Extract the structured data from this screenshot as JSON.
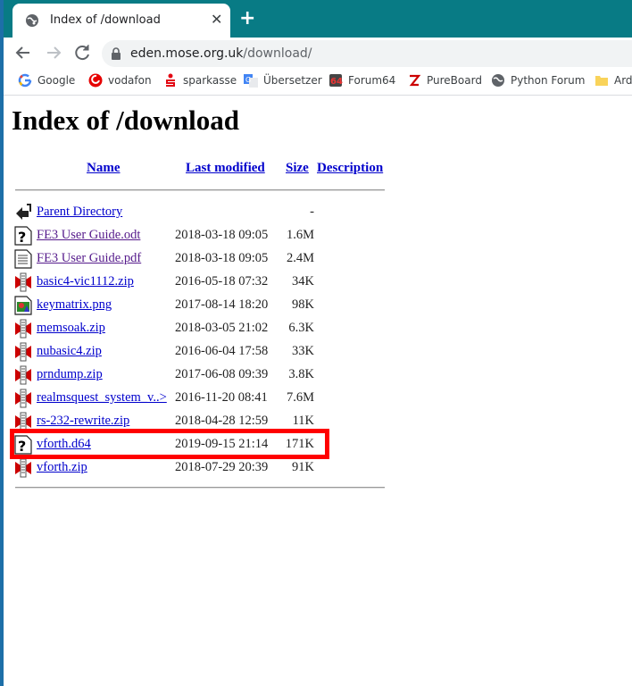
{
  "tab": {
    "title": "Index of /download",
    "close": "✕"
  },
  "newtab": "+",
  "url": {
    "host": "eden.mose.org.uk",
    "path": "/download/"
  },
  "bookmarks": [
    {
      "label": "Google",
      "icon": "google-icon"
    },
    {
      "label": "vodafon",
      "icon": "vodafone-icon"
    },
    {
      "label": "sparkasse",
      "icon": "sparkasse-icon"
    },
    {
      "label": "Übersetzer",
      "icon": "translate-icon"
    },
    {
      "label": "Forum64",
      "icon": "forum64-icon"
    },
    {
      "label": "PureBoard",
      "icon": "pureboard-icon"
    },
    {
      "label": "Python Forum",
      "icon": "globe-icon"
    },
    {
      "label": "Ard",
      "icon": "folder-icon"
    }
  ],
  "page": {
    "title": "Index of /download",
    "headers": {
      "name": "Name",
      "modified": "Last modified",
      "size": "Size",
      "description": "Description"
    },
    "rows": [
      {
        "name": "Parent Directory",
        "date": "",
        "size": "-",
        "icon": "back-icon"
      },
      {
        "name": "FE3 User Guide.odt",
        "date": "2018-03-18 09:05",
        "size": "1.6M",
        "icon": "unknown-file-icon"
      },
      {
        "name": "FE3 User Guide.pdf",
        "date": "2018-03-18 09:05",
        "size": "2.4M",
        "icon": "text-file-icon"
      },
      {
        "name": "basic4-vic1112.zip",
        "date": "2016-05-18 07:32",
        "size": "34K",
        "icon": "compressed-icon"
      },
      {
        "name": "keymatrix.png",
        "date": "2017-08-14 18:20",
        "size": "98K",
        "icon": "image-icon"
      },
      {
        "name": "memsoak.zip",
        "date": "2018-03-05 21:02",
        "size": "6.3K",
        "icon": "compressed-icon"
      },
      {
        "name": "nubasic4.zip",
        "date": "2016-06-04 17:58",
        "size": "33K",
        "icon": "compressed-icon"
      },
      {
        "name": "prndump.zip",
        "date": "2017-06-08 09:39",
        "size": "3.8K",
        "icon": "compressed-icon"
      },
      {
        "name": "realmsquest_system_v..>",
        "date": "2016-11-20 08:41",
        "size": "7.6M",
        "icon": "compressed-icon"
      },
      {
        "name": "rs-232-rewrite.zip",
        "date": "2018-04-28 12:59",
        "size": "11K",
        "icon": "compressed-icon"
      },
      {
        "name": "vforth.d64",
        "date": "2019-09-15 21:14",
        "size": "171K",
        "icon": "unknown-file-icon"
      },
      {
        "name": "vforth.zip",
        "date": "2018-07-29 20:39",
        "size": "91K",
        "icon": "compressed-icon"
      }
    ]
  }
}
